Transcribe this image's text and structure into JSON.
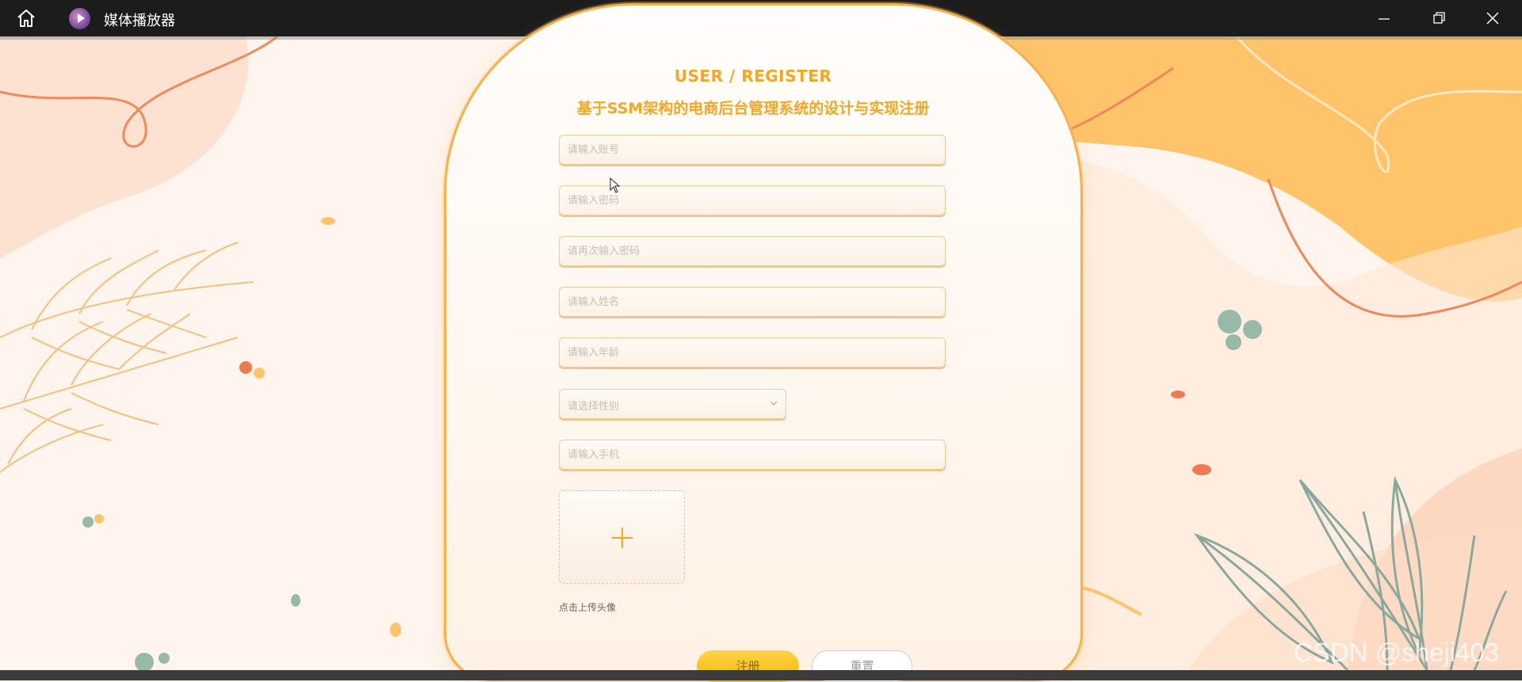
{
  "window": {
    "title": "媒体播放器",
    "icons": {
      "home": "home-icon",
      "app": "media-player-icon",
      "minimize": "minimize-icon",
      "maximize": "restore-icon",
      "close": "close-icon"
    }
  },
  "form": {
    "heading_en": "USER / REGISTER",
    "heading_cn": "基于SSM架构的电商后台管理系统的设计与实现注册",
    "fields": {
      "account": "请输入账号",
      "password": "请输入密码",
      "password_confirm": "请再次输入密码",
      "name": "请输入姓名",
      "age": "请输入年龄",
      "phone": "请输入手机"
    },
    "gender_select": {
      "placeholder": "请选择性别"
    },
    "avatar_upload": {
      "label": "点击上传头像"
    },
    "buttons": {
      "register": "注册",
      "reset": "重置"
    }
  },
  "watermark": "CSDN @sheji403",
  "colors": {
    "accent": "#f5a623",
    "titlebar": "#1c1c1c",
    "button_yellow": "#ffc824"
  }
}
